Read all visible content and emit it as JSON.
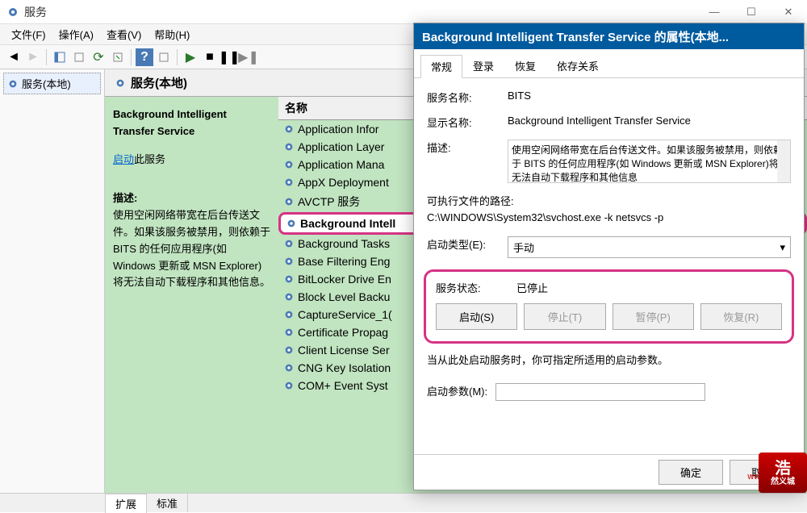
{
  "window": {
    "title": "服务",
    "controls": {
      "min": "—",
      "max": "☐",
      "close": "✕"
    }
  },
  "menubar": [
    "文件(F)",
    "操作(A)",
    "查看(V)",
    "帮助(H)"
  ],
  "tree": {
    "root": "服务(本地)"
  },
  "midpane": {
    "heading": "服务(本地)",
    "selected_service": "Background Intelligent Transfer Service",
    "start_prefix": "启动",
    "start_suffix": "此服务",
    "desc_label": "描述:",
    "desc_text": "使用空闲网络带宽在后台传送文件。如果该服务被禁用，则依赖于 BITS 的任何应用程序(如 Windows 更新或 MSN Explorer)将无法自动下载程序和其他信息。",
    "col_name": "名称",
    "services": [
      "Application Infor",
      "Application Layer",
      "Application Mana",
      "AppX Deployment",
      "AVCTP 服务",
      "Background Intell",
      "Background Tasks",
      "Base Filtering Eng",
      "BitLocker Drive En",
      "Block Level Backu",
      "CaptureService_1(",
      "Certificate Propag",
      "Client License Ser",
      "CNG Key Isolation",
      "COM+ Event Syst"
    ],
    "highlighted_index": 5,
    "tabs": {
      "ext": "扩展",
      "std": "标准"
    }
  },
  "dialog": {
    "title": "Background Intelligent Transfer Service 的属性(本地...",
    "tabs": [
      "常规",
      "登录",
      "恢复",
      "依存关系"
    ],
    "labels": {
      "svc_name": "服务名称:",
      "disp_name": "显示名称:",
      "desc": "描述:",
      "exe_path": "可执行文件的路径:",
      "startup": "启动类型(E):",
      "status": "服务状态:",
      "hint": "当从此处启动服务时，你可指定所适用的启动参数。",
      "params": "启动参数(M):"
    },
    "values": {
      "svc_name": "BITS",
      "disp_name": "Background Intelligent Transfer Service",
      "desc": "使用空闲网络带宽在后台传送文件。如果该服务被禁用，则依赖于 BITS 的任何应用程序(如 Windows 更新或 MSN Explorer)将无法自动下载程序和其他信息",
      "exe_path": "C:\\WINDOWS\\System32\\svchost.exe -k netsvcs -p",
      "startup": "手动",
      "status": "已停止"
    },
    "buttons": {
      "start": "启动(S)",
      "stop": "停止(T)",
      "pause": "暂停(P)",
      "resume": "恢复(R)",
      "ok": "确定",
      "cancel": "取消"
    }
  },
  "watermark": {
    "url": "www.hryckj.cn",
    "logo1": "浩",
    "logo2": "然义城"
  }
}
